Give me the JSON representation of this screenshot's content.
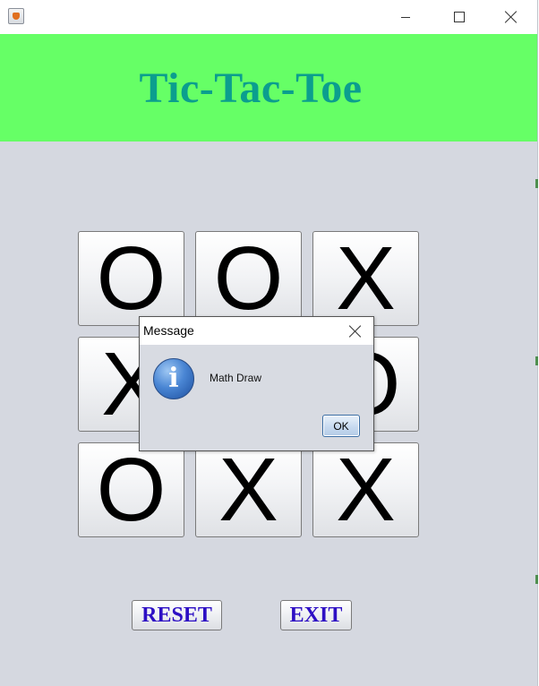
{
  "window": {
    "min_glyph": "minimize",
    "max_glyph": "maximize",
    "close_glyph": "close"
  },
  "header": {
    "title": "Tic-Tac-Toe",
    "color": "#0b9e8e",
    "background": "#66ff66"
  },
  "board": {
    "cells": [
      "O",
      "O",
      "X",
      "X",
      "",
      "O",
      "O",
      "X",
      "X"
    ]
  },
  "controls": {
    "reset_label": "RESET",
    "exit_label": "EXIT",
    "label_color": "#2d0fc4"
  },
  "dialog": {
    "title": "Message",
    "icon": "info-icon",
    "message": "Math Draw",
    "ok_label": "OK"
  }
}
